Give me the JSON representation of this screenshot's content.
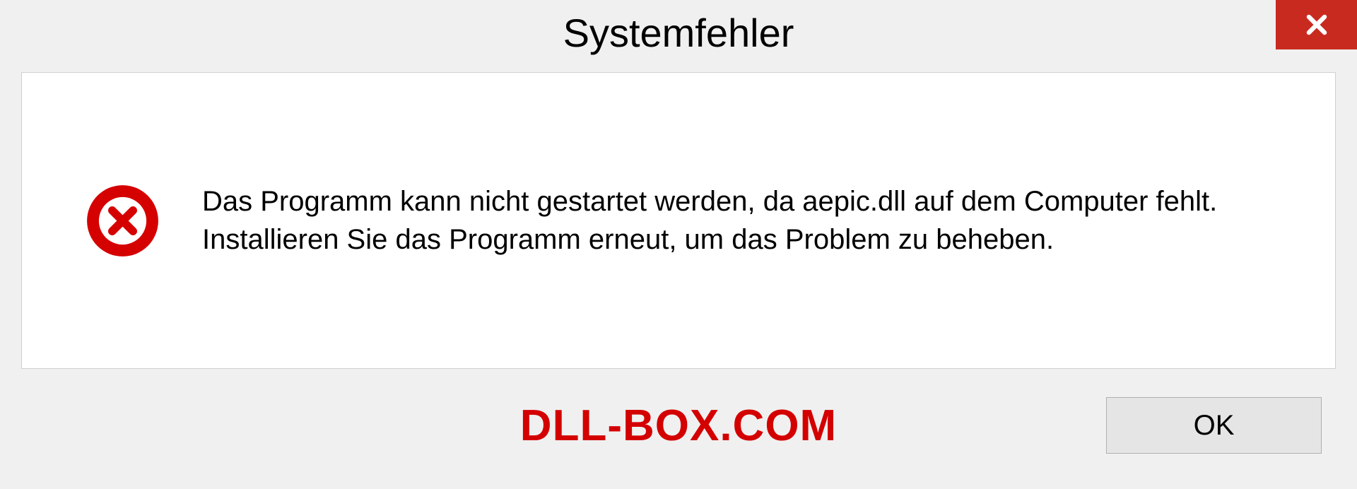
{
  "dialog": {
    "title": "Systemfehler",
    "message": "Das Programm kann nicht gestartet werden, da aepic.dll auf dem Computer fehlt. Installieren Sie das Programm erneut, um das Problem zu beheben.",
    "ok_label": "OK"
  },
  "watermark": "DLL-BOX.COM",
  "colors": {
    "close_button": "#c92a20",
    "error_icon": "#d50000",
    "watermark": "#d40000"
  }
}
